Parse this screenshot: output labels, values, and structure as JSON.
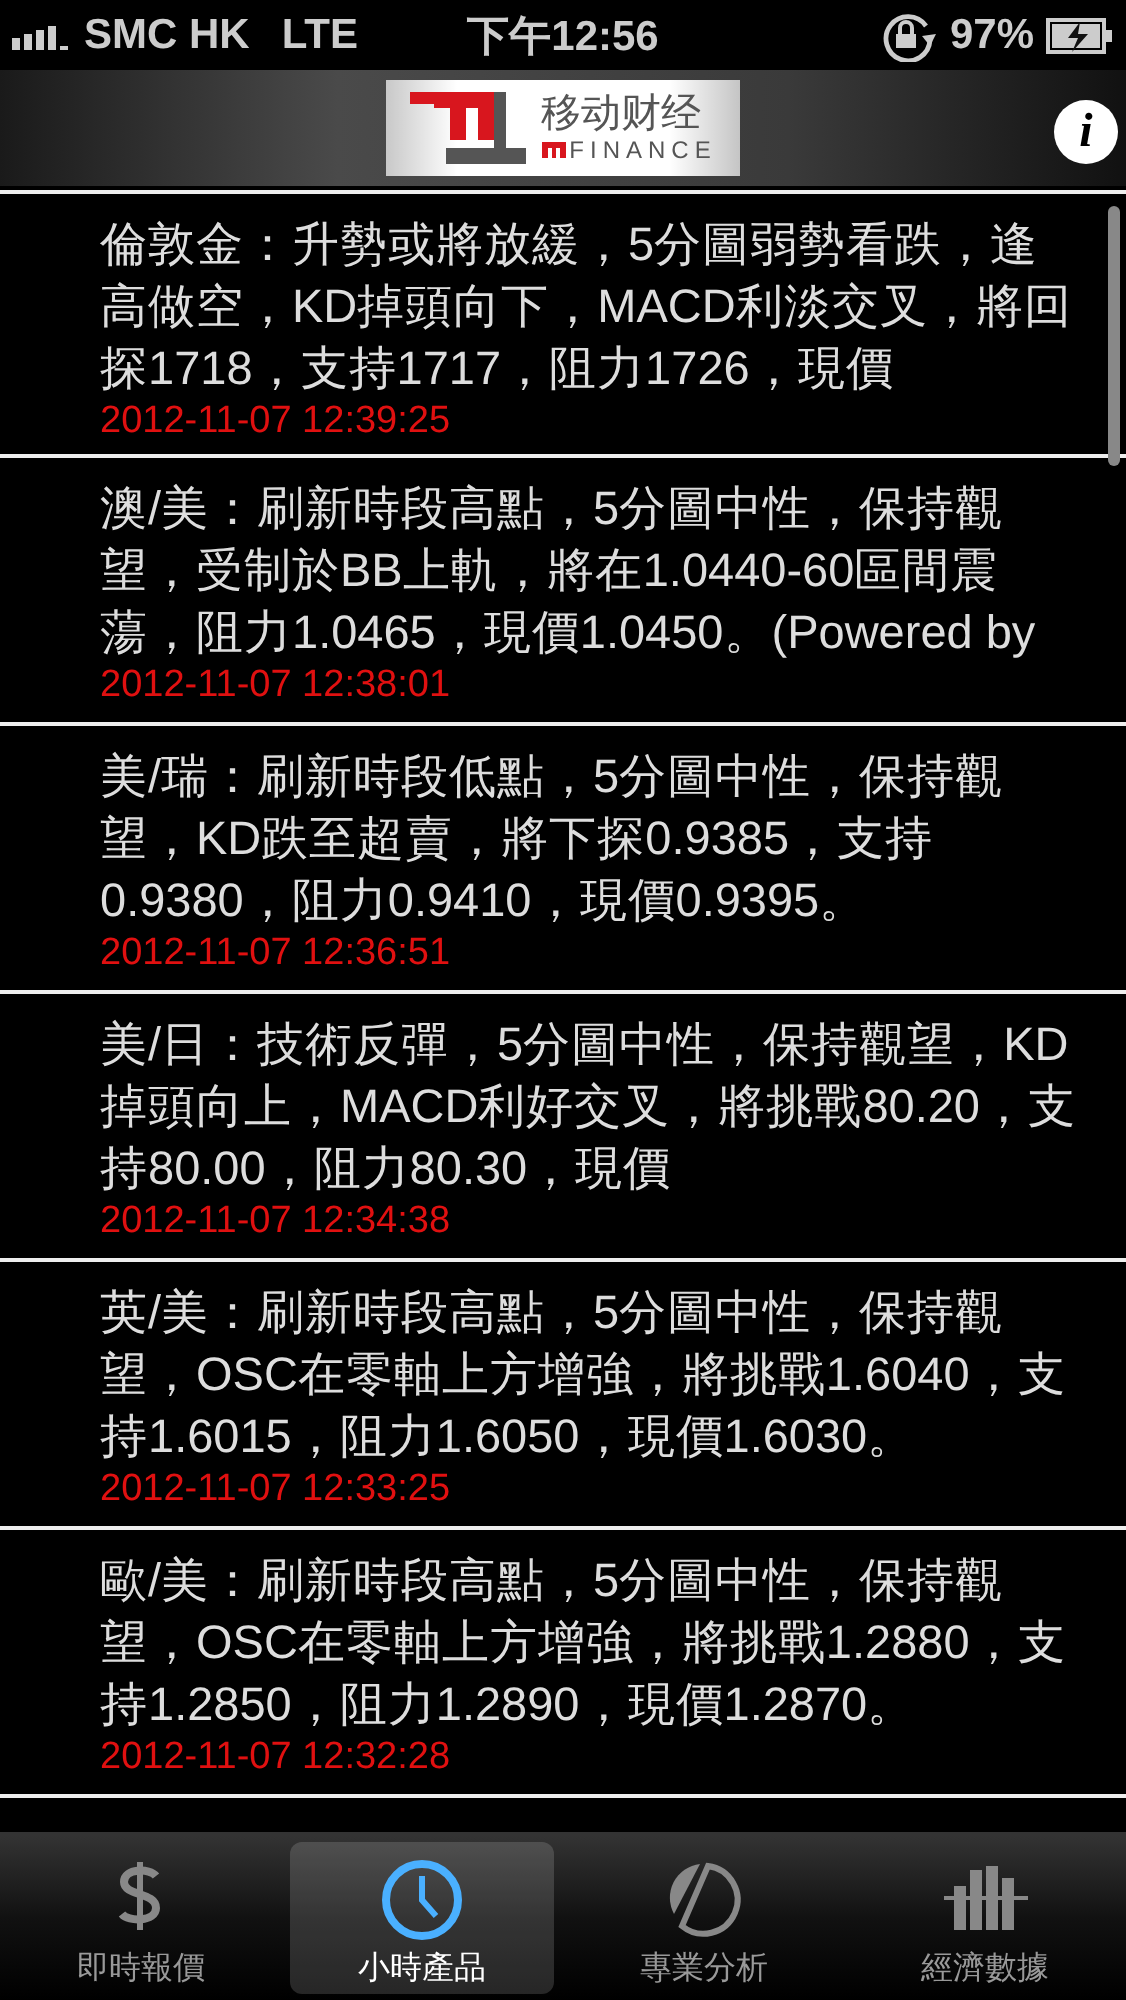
{
  "status_bar": {
    "carrier": "SMC HK",
    "network": "LTE",
    "time": "下午12:56",
    "battery": "97%"
  },
  "header": {
    "logo_title": "移动财经",
    "logo_subtitle": "FINANCE",
    "info_button": "i"
  },
  "news": [
    {
      "text": "倫敦金：升勢或將放緩，5分圖弱勢看跌，逢高做空，KD掉頭向下，MACD利淡交叉，將回探1718，支持1717，阻力1726，現價",
      "time": "2012-11-07 12:39:25"
    },
    {
      "text": "澳/美：刷新時段高點，5分圖中性，保持觀望，受制於BB上軌，將在1.0440-60區間震蕩，阻力1.0465，現價1.0450。(Powered by",
      "time": "2012-11-07 12:38:01"
    },
    {
      "text": "美/瑞：刷新時段低點，5分圖中性，保持觀望，KD跌至超賣，將下探0.9385，支持0.9380，阻力0.9410，現價0.9395。",
      "time": "2012-11-07 12:36:51"
    },
    {
      "text": "美/日：技術反彈，5分圖中性，保持觀望，KD掉頭向上，MACD利好交叉，將挑戰80.20，支持80.00，阻力80.30，現價",
      "time": "2012-11-07 12:34:38"
    },
    {
      "text": "英/美：刷新時段高點，5分圖中性，保持觀望，OSC在零軸上方增強，將挑戰1.6040，支持1.6015，阻力1.6050，現價1.6030。",
      "time": "2012-11-07 12:33:25"
    },
    {
      "text": "歐/美：刷新時段高點，5分圖中性，保持觀望，OSC在零軸上方增強，將挑戰1.2880，支持1.2850，阻力1.2890，現價1.2870。",
      "time": "2012-11-07 12:32:28"
    }
  ],
  "tabs": [
    {
      "label": "即時報價",
      "kind": "dollar",
      "selected": false
    },
    {
      "label": "小時產品",
      "kind": "clock",
      "selected": true
    },
    {
      "label": "專業分析",
      "kind": "pie",
      "selected": false
    },
    {
      "label": "經濟數據",
      "kind": "bars",
      "selected": false
    }
  ]
}
